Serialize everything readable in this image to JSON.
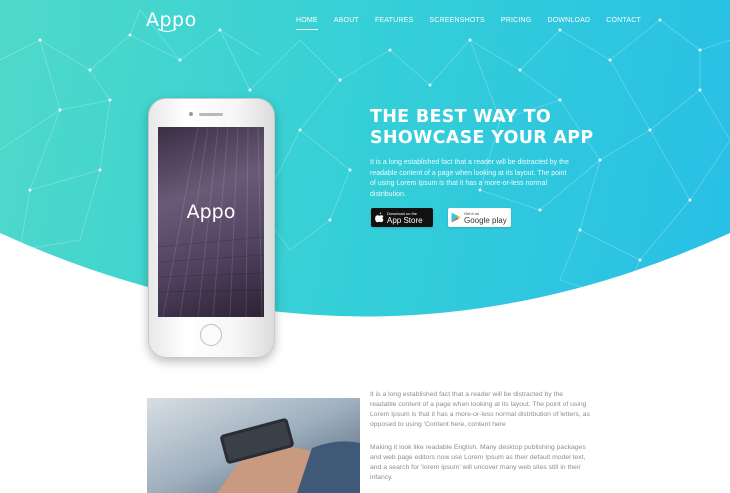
{
  "brand": {
    "logo_text": "Appo"
  },
  "nav": {
    "items": [
      {
        "label": "HOME",
        "active": true
      },
      {
        "label": "ABOUT",
        "active": false
      },
      {
        "label": "FEATURES",
        "active": false
      },
      {
        "label": "SCREENSHOTS",
        "active": false
      },
      {
        "label": "PRICING",
        "active": false
      },
      {
        "label": "DOWNLOAD",
        "active": false
      },
      {
        "label": "CONTACT",
        "active": false
      }
    ]
  },
  "hero": {
    "headline_line1": "THE BEST WAY TO",
    "headline_line2": "SHOWCASE YOUR APP",
    "text": "It is a long established fact that a reader will be distracted by the readable content of a page when looking at its layout. The point of using Lorem Ipsum is that it has a more-or-less normal distribution.",
    "app_store": {
      "small": "Download on the",
      "large": "App Store",
      "icon": "apple-icon"
    },
    "google_play": {
      "small": "Get it on",
      "large": "Google play",
      "icon": "google-play-icon"
    }
  },
  "phone": {
    "screen_logo": "Appo"
  },
  "about": {
    "paragraph1": "It is a long established fact that a reader will be distracted by the readable content of a page when looking at its layout. The point of using Lorem Ipsum is that it has a more-or-less normal distribution of letters, as opposed to using 'Content here, content here",
    "paragraph2": "Making it look like readable English. Many desktop publishing packages and web page editors now use Lorem Ipsum as their default model text, and a search for 'lorem ipsum' will uncover many web sites still in their infancy."
  },
  "colors": {
    "gradient_start": "#4fd9c9",
    "gradient_end": "#28bfe6",
    "text_gray": "#8a8f95"
  }
}
